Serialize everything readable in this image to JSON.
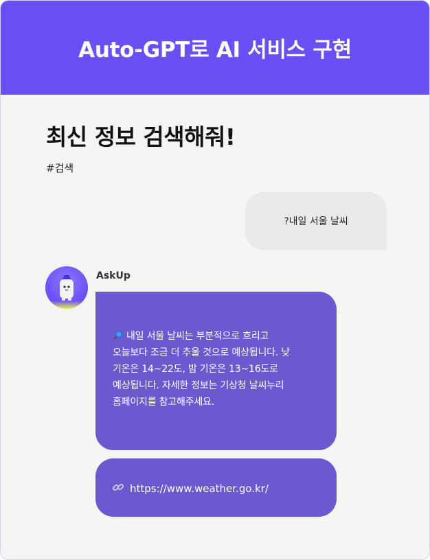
{
  "header": {
    "title": "Auto-GPT로 AI 서비스 구현"
  },
  "page": {
    "title": "최신 정보 검색해줘!",
    "hashtag": "#검색"
  },
  "user_message": {
    "text": "?내일 서울 날씨"
  },
  "bot": {
    "name": "AskUp",
    "message_lines": [
      "내일 서울 날씨는 부분적으로 흐리고",
      "오늘보다 조금 더 추울 것으로 예상됩니다. 낮",
      "기온은 14~22도, 밤 기온은 13~16도로",
      "예상됩니다. 자세한 정보는 기상청 날씨누리",
      "홈페이지를 참고해주세요."
    ],
    "message_icon": "magnifier-icon",
    "link": {
      "icon": "link-icon",
      "text": "https://www.weather.go.kr/"
    }
  },
  "colors": {
    "header_bg": "#6a4ff7",
    "bot_bubble": "#6c58cf",
    "user_bubble": "#e9e9ea",
    "background": "#f5f5f6"
  }
}
